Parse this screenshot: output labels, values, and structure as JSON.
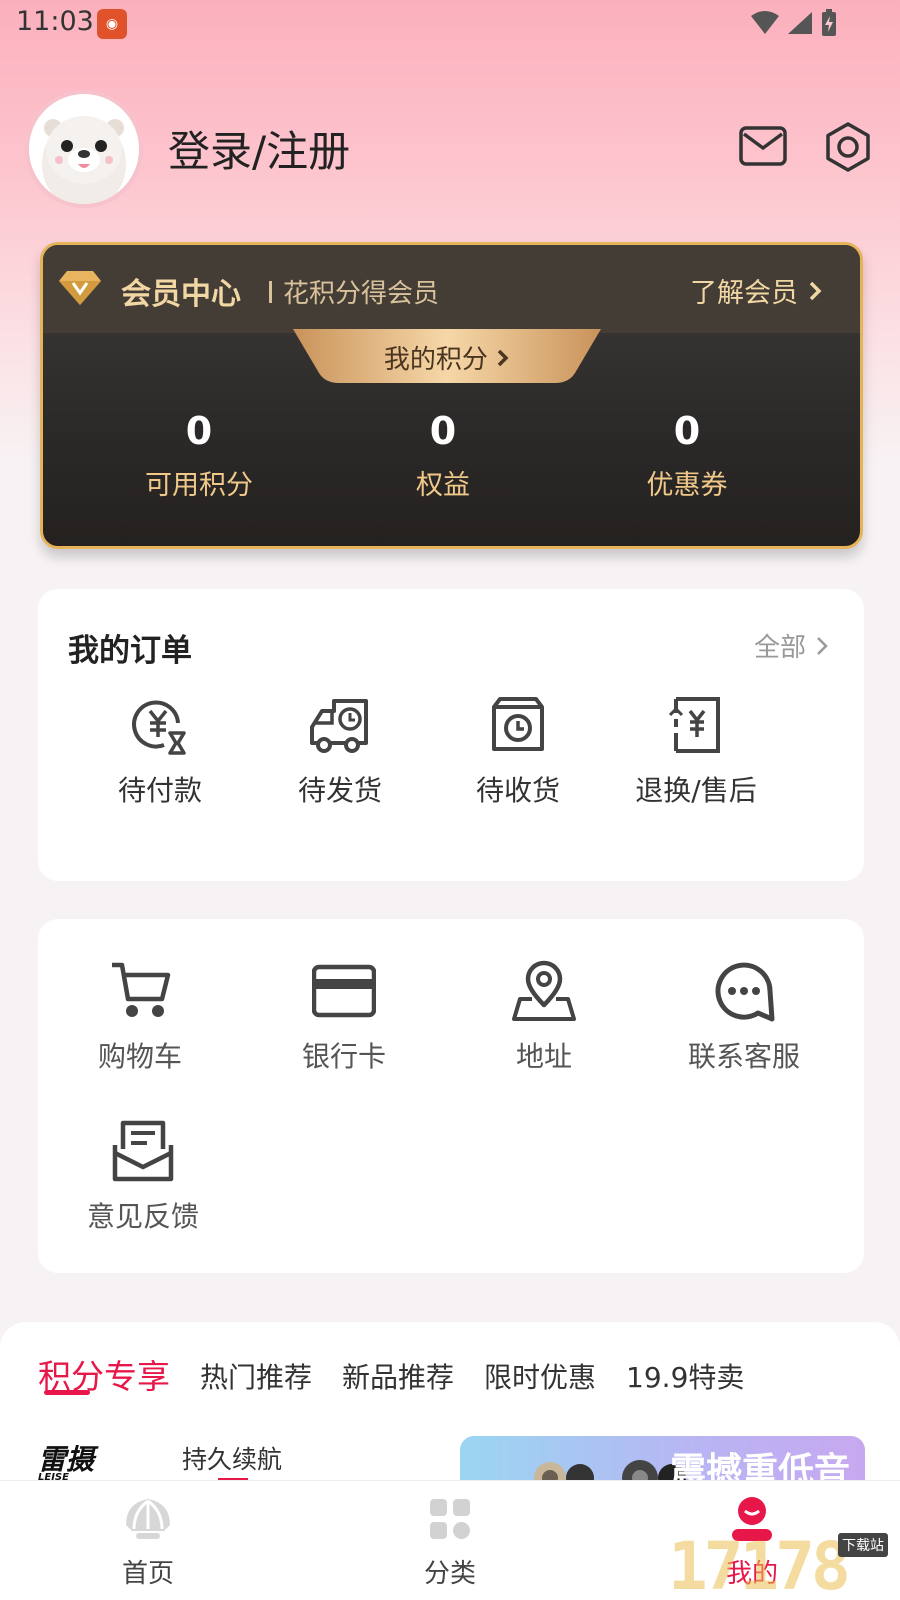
{
  "status_bar": {
    "time": "11:03"
  },
  "profile": {
    "login_label": "登录/注册"
  },
  "member": {
    "title": "会员中心",
    "subtitle": "花积分得会员",
    "learn_more": "了解会员",
    "points_tab": "我的积分",
    "stats": [
      {
        "value": "0",
        "label": "可用积分"
      },
      {
        "value": "0",
        "label": "权益"
      },
      {
        "value": "0",
        "label": "优惠券"
      }
    ]
  },
  "orders": {
    "title": "我的订单",
    "all_label": "全部",
    "items": [
      {
        "label": "待付款",
        "icon": "pending-payment-icon"
      },
      {
        "label": "待发货",
        "icon": "pending-shipment-icon"
      },
      {
        "label": "待收货",
        "icon": "pending-receipt-icon"
      },
      {
        "label": "退换/售后",
        "icon": "after-sales-icon"
      }
    ]
  },
  "tools": {
    "items": [
      {
        "label": "购物车",
        "icon": "cart-icon"
      },
      {
        "label": "银行卡",
        "icon": "bank-card-icon"
      },
      {
        "label": "地址",
        "icon": "address-icon"
      },
      {
        "label": "联系客服",
        "icon": "customer-service-icon"
      },
      {
        "label": "意见反馈",
        "icon": "feedback-icon"
      }
    ]
  },
  "feed": {
    "tabs": [
      "积分专享",
      "热门推荐",
      "新品推荐",
      "限时优惠",
      "19.9特卖"
    ],
    "brand": "雷摄",
    "brand_sub": "LEISE",
    "product_title": "持久续航",
    "banner_text": "震撼重低音"
  },
  "bottom_nav": {
    "items": [
      {
        "label": "首页",
        "icon": "home-shell-icon"
      },
      {
        "label": "分类",
        "icon": "category-grid-icon"
      },
      {
        "label": "我的",
        "icon": "profile-icon"
      }
    ]
  },
  "watermark": {
    "text": "17178",
    "badge": "下载站"
  },
  "colors": {
    "accent": "#e8174a",
    "gold": "#f1d7a4",
    "card_dark": "#2c2a29"
  }
}
